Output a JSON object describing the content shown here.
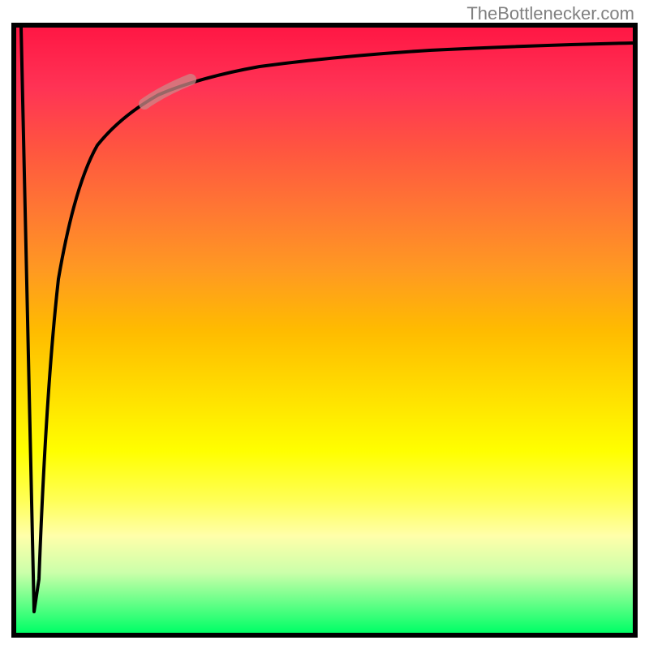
{
  "watermark": "TheBottlenecker.com",
  "chart_data": {
    "type": "line",
    "title": "",
    "xlabel": "",
    "ylabel": "",
    "description": "Bottleneck percentage curve over a red-to-green gradient background. A sharp V-shaped dip near the left edge reaches near zero (green/good), then rises steeply and asymptotically approaches the top (red/bad) as x increases.",
    "x_range": [
      0,
      100
    ],
    "y_range": [
      0,
      100
    ],
    "series": [
      {
        "name": "bottleneck-curve",
        "x": [
          0,
          1.5,
          3,
          4,
          5,
          6,
          8,
          10,
          12,
          15,
          18,
          22,
          26,
          30,
          35,
          40,
          50,
          60,
          70,
          80,
          90,
          100
        ],
        "y": [
          100,
          50,
          2,
          30,
          50,
          62,
          72,
          78,
          82,
          85,
          87,
          89,
          90.5,
          91.5,
          92.4,
          93,
          94,
          94.7,
          95.3,
          95.8,
          96.2,
          96.5
        ]
      }
    ],
    "highlight_segment": {
      "x_start": 22,
      "x_end": 27,
      "note": "faded/highlighted segment of curve"
    },
    "gradient_stops": [
      {
        "pos": 0,
        "color": "#ff1744"
      },
      {
        "pos": 50,
        "color": "#ffdd00"
      },
      {
        "pos": 100,
        "color": "#00ff66"
      }
    ]
  }
}
